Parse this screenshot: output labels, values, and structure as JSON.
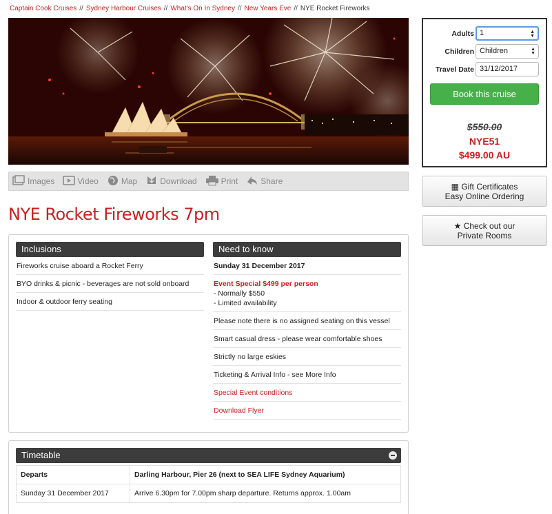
{
  "breadcrumb": {
    "items": [
      "Captain Cook Cruises",
      "Sydney Harbour Cruises",
      "What's On In Sydney",
      "New Years Eve"
    ],
    "separator": "//",
    "current": "NYE Rocket Fireworks"
  },
  "toolbar": {
    "images": "Images",
    "video": "Video",
    "map": "Map",
    "download": "Download",
    "print": "Print",
    "share": "Share"
  },
  "page_title": "NYE Rocket Fireworks 7pm",
  "inclusions": {
    "heading": "Inclusions",
    "items": [
      "Fireworks cruise aboard a Rocket Ferry",
      "BYO drinks & picnic - beverages are not sold onboard",
      "Indoor & outdoor ferry seating"
    ]
  },
  "need_to_know": {
    "heading": "Need to know",
    "date": "Sunday 31 December 2017",
    "special_title": "Event Special $499 per person",
    "special_line1": "- Normally $550",
    "special_line2": "- Limited availability",
    "items": [
      "Please note there is no assigned seating on this vessel",
      "Smart casual dress - please wear comfortable shoes",
      "Strictly no large eskies",
      "Ticketing & Arrival Info - see More Info"
    ],
    "links": [
      "Special Event conditions",
      "Download Flyer"
    ]
  },
  "timetable": {
    "heading": "Timetable",
    "header_row": [
      "Departs",
      "Darling Harbour, Pier 26 (next to SEA LIFE Sydney Aquarium)"
    ],
    "rows": [
      [
        "Sunday 31 December 2017",
        "Arrive 6.30pm for 7.00pm sharp departure. Returns approx. 1.00am"
      ]
    ]
  },
  "booking": {
    "adults_label": "Adults",
    "adults_value": "1",
    "children_label": "Children",
    "children_value": "Children",
    "date_label": "Travel Date",
    "date_value": "31/12/2017",
    "book_label": "Book this cruise",
    "price_old": "$550.00",
    "price_code": "NYE51",
    "price_new": "$499.00 AU"
  },
  "side_buttons": {
    "gift_line1": "Gift Certificates",
    "gift_line2": "Easy Online Ordering",
    "private_line1": "Check out our",
    "private_line2": "Private Rooms"
  },
  "colors": {
    "brand_red": "#cc1f1f",
    "book_green": "#46b049",
    "header_dark": "#3c3c3c"
  }
}
